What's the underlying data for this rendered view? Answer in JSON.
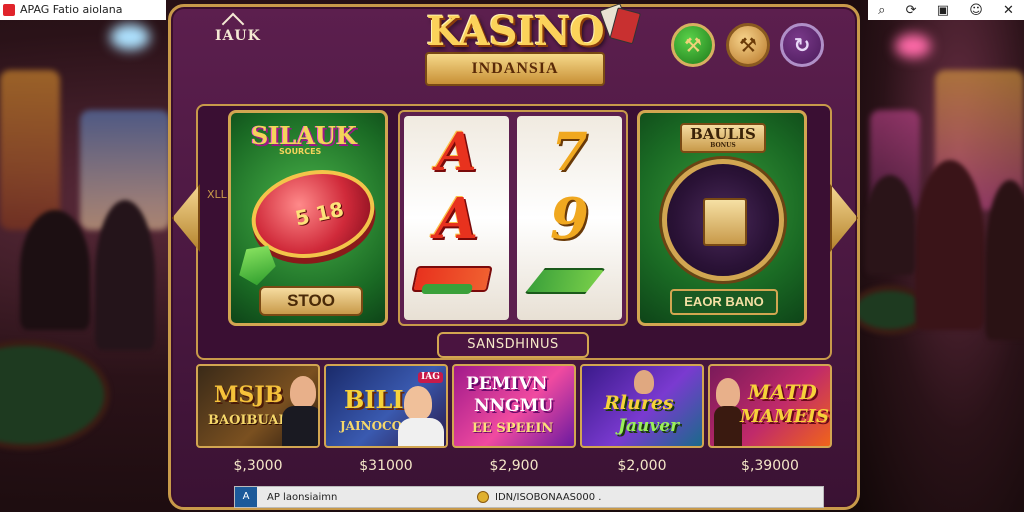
{
  "window": {
    "title": "APAG Fatio aiolana",
    "controls": [
      "search-icon",
      "refresh-icon",
      "screen-icon",
      "emoji-icon",
      "close-icon"
    ],
    "control_glyphs": [
      "⌕",
      "⟳",
      "▣",
      "☺",
      "✕"
    ]
  },
  "header": {
    "small_logo": "IAUK",
    "brand_title": "KASINO",
    "brand_subtitle": "INDANSIA",
    "buttons": [
      {
        "name": "green-hammer-button",
        "glyph": "⚒"
      },
      {
        "name": "gold-tools-button",
        "glyph": "⚒"
      },
      {
        "name": "refresh-button",
        "glyph": "↻"
      }
    ]
  },
  "reels": {
    "left_card": {
      "tag": "SILAUK",
      "sub": "SOURCES",
      "chip_text": "5 18",
      "button": "STOO"
    },
    "center": {
      "reel1": [
        "A",
        "A"
      ],
      "reel2": [
        "7",
        "9"
      ]
    },
    "right_card": {
      "tag": "BAULIS",
      "tag_sub": "BONUS",
      "label": "EAOR BANO"
    },
    "side_ornament": "XLL•L°",
    "banner": "SANSDHINUS"
  },
  "games": [
    {
      "title": "MSJB BAOIBUAIN",
      "line1": "MSJB",
      "line2": "BAOIBUAIN",
      "price": "$,3000"
    },
    {
      "title": "BILI JAINOCO",
      "line1": "BILI",
      "line2": "JAINOCO",
      "badge": "IAG",
      "price": "$31000"
    },
    {
      "title": "PEMIVN NNGMU EE SPEEIN",
      "line1": "PEMIVN",
      "line2": "NNGMU",
      "line3": "EE SPEEIN",
      "price": "$2,900"
    },
    {
      "title": "Rlures Jauver",
      "line1": "Rlures",
      "line2": "Jauver",
      "price": "$2,000"
    },
    {
      "title": "MATD MAMEIS",
      "line1": "MATD",
      "line2": "MAMEIS",
      "price": "$,39000"
    }
  ],
  "statusbar": {
    "left_icon": "A",
    "left_text": "AP  laonsiaimn",
    "right_text": "IDN/ISOBONAAS000 ."
  },
  "colors": {
    "panel": "#5c1f4e",
    "gold_border": "#c89a4a",
    "green_felt": "#1a6a24",
    "reel_red": "#e8321e",
    "reel_gold": "#f0a820"
  }
}
